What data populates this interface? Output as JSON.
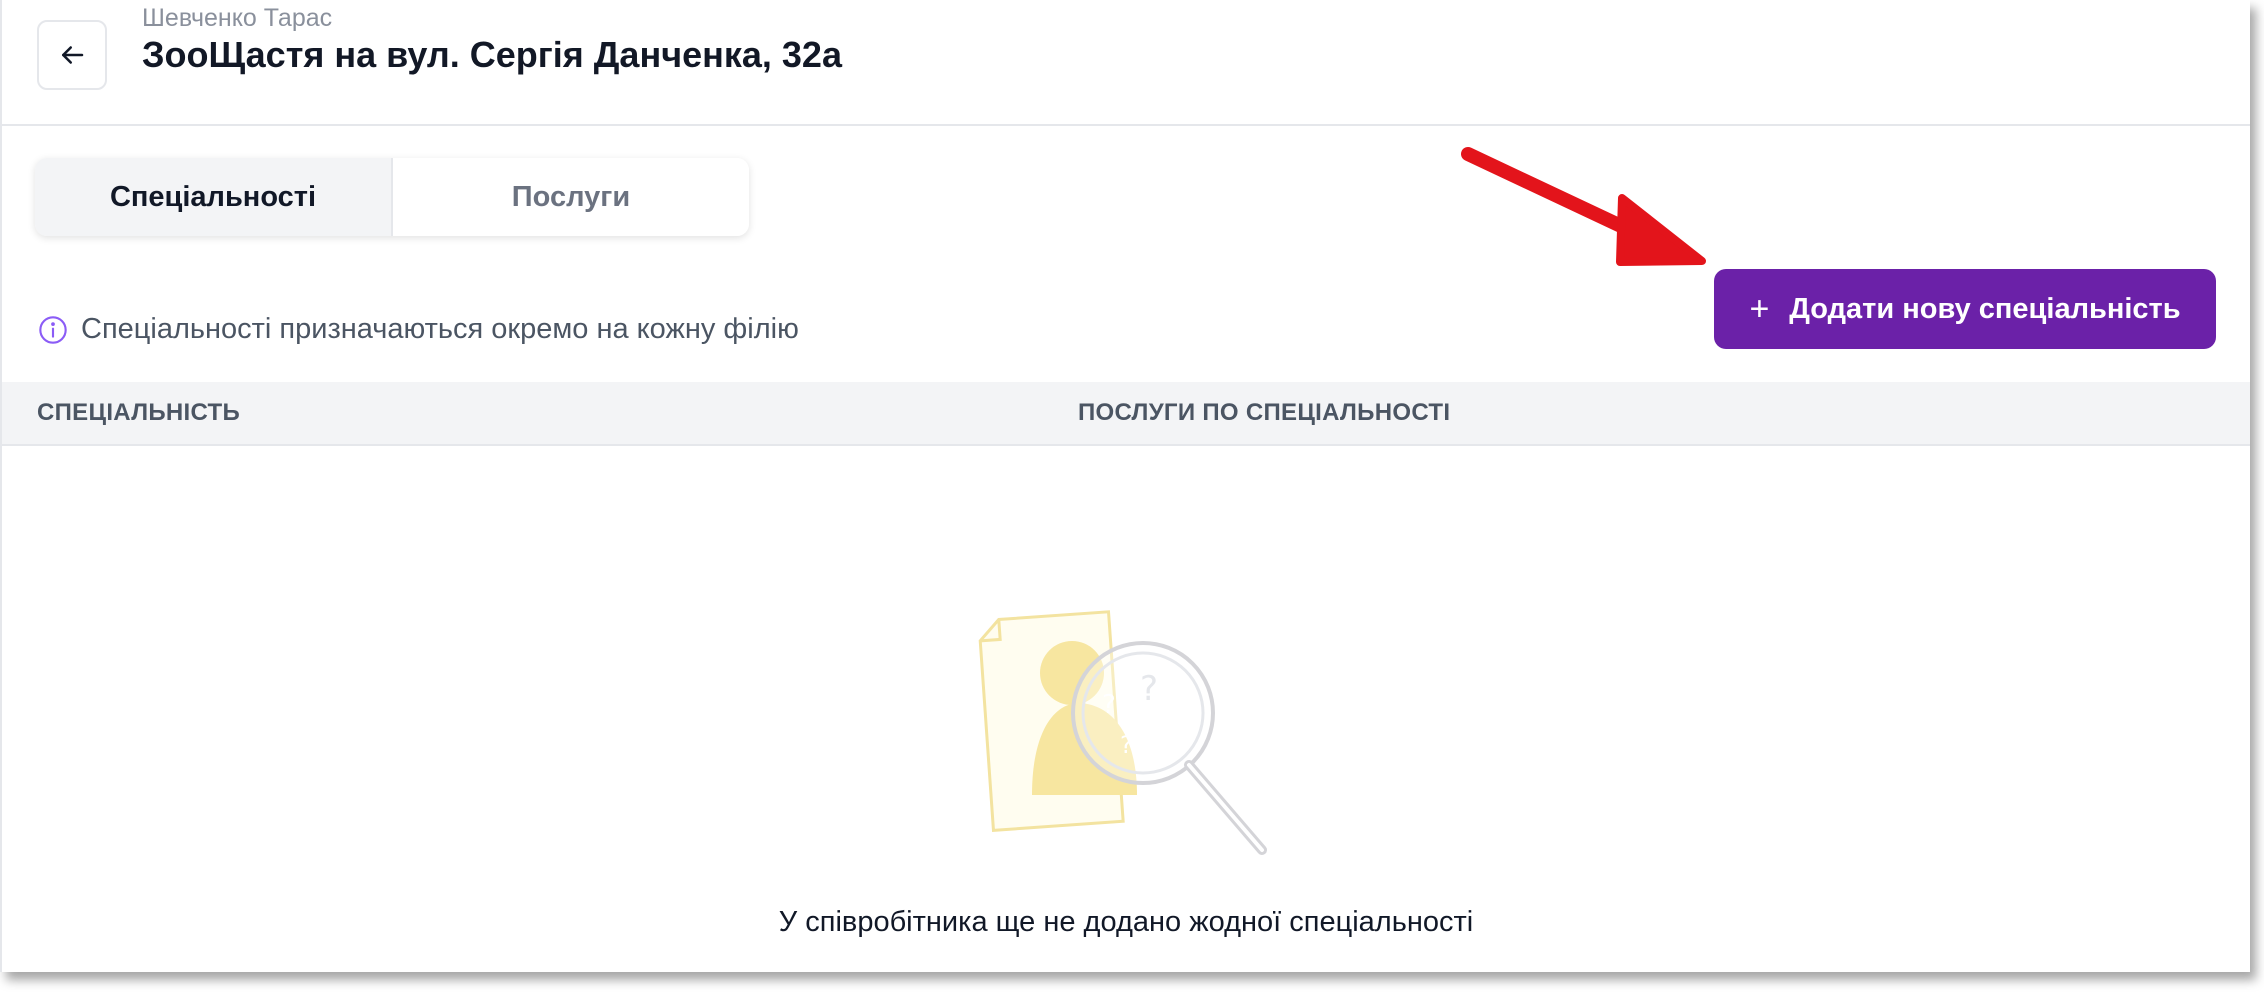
{
  "header": {
    "subtitle": "Шевченко Тарас",
    "title": "ЗооЩастя на вул. Сергія Данченка, 32а",
    "back_icon": "arrow-left-icon"
  },
  "tabs": [
    {
      "label": "Спеціальності",
      "active": true
    },
    {
      "label": "Послуги",
      "active": false
    }
  ],
  "info": {
    "icon": "info-circle-icon",
    "text": "Спеціальності призначаються окремо на кожну філію"
  },
  "add_button": {
    "icon": "plus",
    "label": "Додати нову спеціальність",
    "color": "#6b21a8"
  },
  "table": {
    "columns": [
      "СПЕЦІАЛЬНІСТЬ",
      "ПОСЛУГИ ПО СПЕЦІАЛЬНОСТІ"
    ]
  },
  "empty_state": {
    "illustration": "search-document-illustration",
    "text": "У співробітника ще не додано жодної спеціальності"
  },
  "annotation": {
    "arrow_color": "#e3141b"
  }
}
